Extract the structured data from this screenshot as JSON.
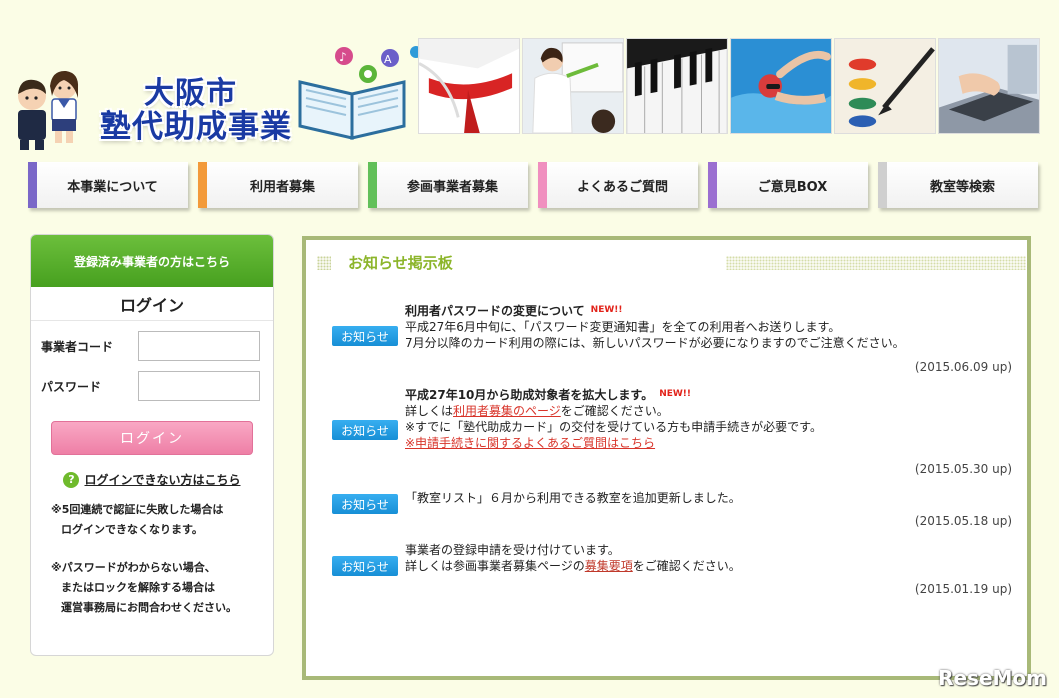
{
  "header": {
    "logo_line1": "大阪市",
    "logo_line2": "塾代助成事業",
    "photos": [
      "martial-arts-photo",
      "teacher-photo",
      "piano-photo",
      "swimming-photo",
      "painting-photo",
      "laptop-photo"
    ]
  },
  "nav": {
    "items": [
      {
        "label": "本事業について",
        "color": "#7a67c8"
      },
      {
        "label": "利用者募集",
        "color": "#f39a3a"
      },
      {
        "label": "参画事業者募集",
        "color": "#62c05a"
      },
      {
        "label": "よくあるご質問",
        "color": "#f08fbf"
      },
      {
        "label": "ご意見BOX",
        "color": "#9b6fd1"
      },
      {
        "label": "教室等検索",
        "color": "#cfcfcf"
      }
    ]
  },
  "login": {
    "header": "登録済み事業者の方はこちら",
    "title": "ログイン",
    "code_label": "事業者コード",
    "password_label": "パスワード",
    "button": "ログイン",
    "help_link": "ログインできない方はこちら",
    "note1_line1": "※5回連続で認証に失敗した場合は",
    "note1_line2": "ログインできなくなります。",
    "note2_line1": "※パスワードがわからない場合、",
    "note2_line2": "またはロックを解除する場合は",
    "note2_line3": "運営事務局にお問合わせください。"
  },
  "board": {
    "title": "お知らせ掲示板",
    "badge": "お知らせ",
    "new_tag": "NEW!!",
    "news": [
      {
        "title": "利用者パスワードの変更について",
        "line1": "平成27年6月中旬に、「パスワード変更通知書」を全ての利用者へお送りします。",
        "line2": "7月分以降のカード利用の際には、新しいパスワードが必要になりますのでご注意ください。",
        "date": "(2015.06.09 up)"
      },
      {
        "title": "平成27年10月から助成対象者を拡大します。",
        "line1_pre": "詳しくは",
        "line1_link": "利用者募集のページ",
        "line1_post": "をご確認ください。",
        "line2": "※すでに「塾代助成カード」の交付を受けている方も申請手続きが必要です。",
        "line3_link": "※申請手続きに関するよくあるご質問はこちら",
        "date": "(2015.05.30 up)"
      },
      {
        "line1": "「教室リスト」６月から利用できる教室を追加更新しました。",
        "date": "(2015.05.18 up)"
      },
      {
        "line1": "事業者の登録申請を受け付けています。",
        "line2_pre": "詳しくは参画事業者募集ページの",
        "line2_link": "募集要項",
        "line2_post": "をご確認ください。",
        "date": "(2015.01.19 up)"
      }
    ]
  },
  "watermark": "ReseMom"
}
